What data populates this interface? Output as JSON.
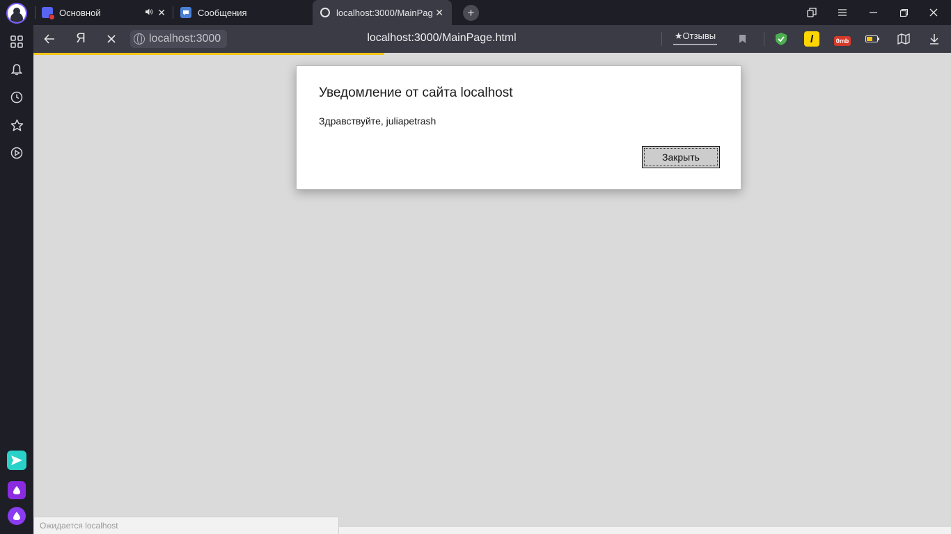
{
  "tabs": [
    {
      "label": "Основной",
      "favicon_color": "#5865f2",
      "muted_icon": "speaker-icon",
      "close": "✕"
    },
    {
      "label": "Сообщения",
      "favicon_color": "#4a7fd6"
    },
    {
      "label": "localhost:3000/MainPag",
      "active": true,
      "close": "✕"
    }
  ],
  "new_tab_label": "+",
  "toolbar": {
    "origin": "localhost:3000",
    "page_url": "localhost:3000/MainPage.html",
    "reviews_label": "★Отзывы",
    "yandex_label": "Я",
    "ext_vpn_color": "#4caf50",
    "ext_l_label": "l",
    "ext_omb_label": "0mb",
    "accent_color": "#f5c518"
  },
  "dialog": {
    "title": "Уведомление от сайта localhost",
    "message": "Здравствуйте, juliapetrash",
    "close_button": "Закрыть"
  },
  "status": {
    "text": "Ожидается localhost"
  }
}
